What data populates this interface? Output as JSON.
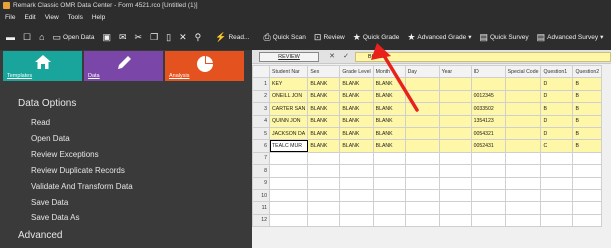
{
  "window": {
    "title": "Remark Classic OMR Data Center - Form 4521.rco [Untitled (1)]"
  },
  "menu": [
    "File",
    "Edit",
    "View",
    "Tools",
    "Help"
  ],
  "toolbar": {
    "open_data": "Open Data",
    "read": "Read...",
    "quick_scan": "Quick Scan",
    "review": "Review",
    "quick_grade": "Quick Grade",
    "advanced_grade": "Advanced Grade",
    "quick_survey": "Quick Survey",
    "advanced_survey": "Advanced Survey"
  },
  "tiles": {
    "templates": "Templates",
    "data": "Data",
    "analysis": "Analysis",
    "colors": {
      "templates": "#1aa59c",
      "data": "#7a46a8",
      "analysis": "#e4531f"
    }
  },
  "sidebar": {
    "section_data_options": "Data Options",
    "items": [
      "Read",
      "Open Data",
      "Review Exceptions",
      "Review Duplicate Records",
      "Validate And Transform Data",
      "Save Data",
      "Save Data As"
    ],
    "section_advanced": "Advanced"
  },
  "grid_toolbar": {
    "review_label": "REVIEW",
    "cell_value": "BLANK"
  },
  "grid": {
    "columns": [
      "Student Nar",
      "Sex",
      "Grade Level",
      "Month",
      "Day",
      "Year",
      "ID",
      "Special Code",
      "Question1",
      "Question2"
    ],
    "rows": [
      {
        "num": "1",
        "cells": [
          "KEY",
          "BLANK",
          "BLANK",
          "BLANK",
          "",
          "",
          "",
          "",
          "D",
          "B"
        ]
      },
      {
        "num": "2",
        "cells": [
          "ONEILL JON",
          "BLANK",
          "BLANK",
          "BLANK",
          "",
          "",
          "0012345",
          "",
          "D",
          "B"
        ]
      },
      {
        "num": "3",
        "cells": [
          "CARTER SAN",
          "BLANK",
          "BLANK",
          "BLANK",
          "",
          "",
          "0033502",
          "",
          "B",
          "B"
        ]
      },
      {
        "num": "4",
        "cells": [
          "QUINN JON",
          "BLANK",
          "BLANK",
          "BLANK",
          "",
          "",
          "1354123",
          "",
          "D",
          "B"
        ]
      },
      {
        "num": "5",
        "cells": [
          "JACKSON DA",
          "BLANK",
          "BLANK",
          "BLANK",
          "",
          "",
          "0054321",
          "",
          "D",
          "B"
        ]
      },
      {
        "num": "6",
        "cells": [
          "TEALC MUR",
          "BLANK",
          "BLANK",
          "BLANK",
          "",
          "",
          "0052431",
          "",
          "C",
          "B"
        ]
      }
    ],
    "empty_rows": [
      "7",
      "8",
      "9",
      "10",
      "11",
      "12"
    ],
    "last_col_overflow": [
      "E",
      "A",
      "E",
      "E",
      "E",
      "E"
    ]
  },
  "colors": {
    "accent_arrow": "#e8211d",
    "cell_yellow": "#fff7a8"
  }
}
